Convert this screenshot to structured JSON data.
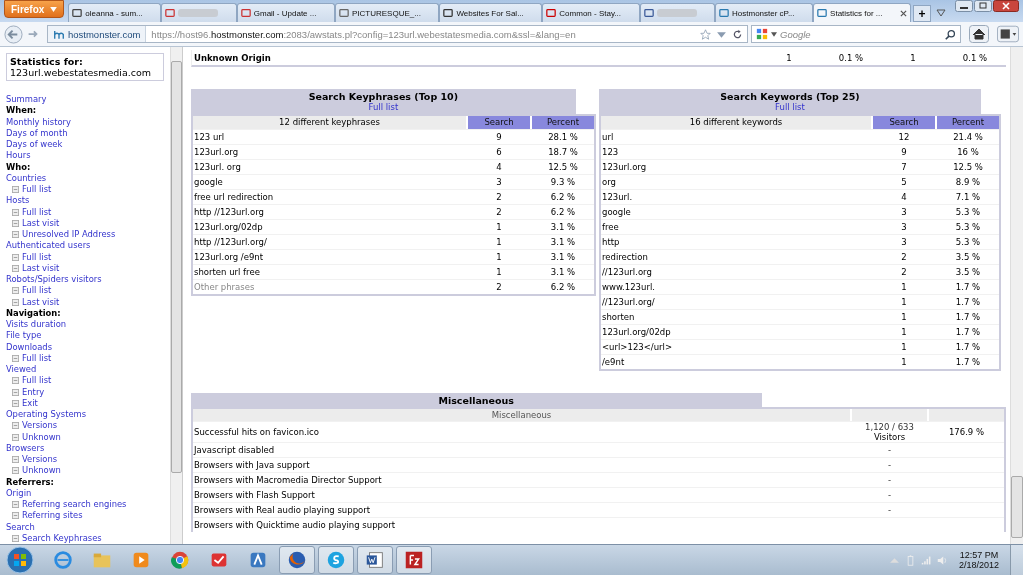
{
  "browser": {
    "menu_button": "Firefox",
    "tabs": [
      {
        "title": "oleanna - sum...",
        "redacted": false,
        "selected": false
      },
      {
        "redacted": true,
        "selected": false
      },
      {
        "title": "Gmail - Update ...",
        "redacted": false,
        "selected": false
      },
      {
        "title": "PICTURESQUE_...",
        "redacted": false,
        "selected": false
      },
      {
        "title": "Websites For Sal...",
        "redacted": false,
        "selected": false
      },
      {
        "title": "Common - Stay...",
        "redacted": false,
        "selected": false
      },
      {
        "redacted": true,
        "selected": false
      },
      {
        "title": "Hostmonster cP...",
        "redacted": false,
        "selected": false
      },
      {
        "title": "Statistics for ...",
        "redacted": false,
        "selected": true
      }
    ],
    "new_tab": "+",
    "site_identity": "hostmonster.com",
    "url": "https://host96.**hostmonster.com**:2083/awstats.pl?config=123url.webestatesmedia.com&ssl=&lang=en",
    "search": {
      "placeholder": "Google"
    }
  },
  "sidebar": {
    "stats_for_label": "Statistics for:",
    "domain": "123url.webestatesmedia.com",
    "items": [
      {
        "kind": "link",
        "text": "Summary"
      },
      {
        "kind": "heading",
        "text": "When:"
      },
      {
        "kind": "link",
        "text": "Monthly history"
      },
      {
        "kind": "link",
        "text": "Days of month"
      },
      {
        "kind": "link",
        "text": "Days of week"
      },
      {
        "kind": "link",
        "text": "Hours"
      },
      {
        "kind": "heading",
        "text": "Who:"
      },
      {
        "kind": "link",
        "text": "Countries"
      },
      {
        "kind": "sublink",
        "text": "Full list"
      },
      {
        "kind": "link",
        "text": "Hosts"
      },
      {
        "kind": "sublink",
        "text": "Full list"
      },
      {
        "kind": "sublink",
        "text": "Last visit"
      },
      {
        "kind": "sublink",
        "text": "Unresolved IP Address"
      },
      {
        "kind": "link",
        "text": "Authenticated users"
      },
      {
        "kind": "sublink",
        "text": "Full list"
      },
      {
        "kind": "sublink",
        "text": "Last visit"
      },
      {
        "kind": "link",
        "text": "Robots/Spiders visitors"
      },
      {
        "kind": "sublink",
        "text": "Full list"
      },
      {
        "kind": "sublink",
        "text": "Last visit"
      },
      {
        "kind": "heading",
        "text": "Navigation:"
      },
      {
        "kind": "link",
        "text": "Visits duration"
      },
      {
        "kind": "link",
        "text": "File type"
      },
      {
        "kind": "link",
        "text": "Downloads"
      },
      {
        "kind": "sublink",
        "text": "Full list"
      },
      {
        "kind": "link",
        "text": "Viewed"
      },
      {
        "kind": "sublink",
        "text": "Full list"
      },
      {
        "kind": "sublink",
        "text": "Entry"
      },
      {
        "kind": "sublink",
        "text": "Exit"
      },
      {
        "kind": "link",
        "text": "Operating Systems"
      },
      {
        "kind": "sublink",
        "text": "Versions"
      },
      {
        "kind": "sublink",
        "text": "Unknown"
      },
      {
        "kind": "link",
        "text": "Browsers"
      },
      {
        "kind": "sublink",
        "text": "Versions"
      },
      {
        "kind": "sublink",
        "text": "Unknown"
      },
      {
        "kind": "heading",
        "text": "Referrers:"
      },
      {
        "kind": "link",
        "text": "Origin"
      },
      {
        "kind": "sublink",
        "text": "Referring search engines"
      },
      {
        "kind": "sublink",
        "text": "Referring sites"
      },
      {
        "kind": "link",
        "text": "Search"
      },
      {
        "kind": "sublink",
        "text": "Search Keyphrases"
      }
    ]
  },
  "origin_row": {
    "label": "Unknown Origin",
    "pages": "1",
    "pages_percent": "0.1 %",
    "hits": "1",
    "hits_percent": "0.1 %"
  },
  "keyphrases": {
    "title": "Search Keyphrases (Top 10)",
    "full_list": "Full list",
    "count_label": "12 different keyphrases",
    "columns": [
      "Search",
      "Percent"
    ],
    "rows": [
      {
        "text": "123 url",
        "search": "9",
        "percent": "28.1 %",
        "muted": false
      },
      {
        "text": "123url.org",
        "search": "6",
        "percent": "18.7 %",
        "muted": false
      },
      {
        "text": "123url. org",
        "search": "4",
        "percent": "12.5 %",
        "muted": false
      },
      {
        "text": "google",
        "search": "3",
        "percent": "9.3 %",
        "muted": false
      },
      {
        "text": "free url redirection",
        "search": "2",
        "percent": "6.2 %",
        "muted": false
      },
      {
        "text": "http //123url.org",
        "search": "2",
        "percent": "6.2 %",
        "muted": false
      },
      {
        "text": "123url.org/02dp",
        "search": "1",
        "percent": "3.1 %",
        "muted": false
      },
      {
        "text": "http //123url.org/",
        "search": "1",
        "percent": "3.1 %",
        "muted": false
      },
      {
        "text": "123url.org /e9nt",
        "search": "1",
        "percent": "3.1 %",
        "muted": false
      },
      {
        "text": "shorten url free",
        "search": "1",
        "percent": "3.1 %",
        "muted": false
      },
      {
        "text": "Other phrases",
        "search": "2",
        "percent": "6.2 %",
        "muted": true
      }
    ]
  },
  "keywords": {
    "title": "Search Keywords (Top 25)",
    "full_list": "Full list",
    "count_label": "16 different keywords",
    "columns": [
      "Search",
      "Percent"
    ],
    "rows": [
      {
        "text": "url",
        "search": "12",
        "percent": "21.4 %"
      },
      {
        "text": "123",
        "search": "9",
        "percent": "16 %"
      },
      {
        "text": "123url.org",
        "search": "7",
        "percent": "12.5 %"
      },
      {
        "text": "org",
        "search": "5",
        "percent": "8.9 %"
      },
      {
        "text": "123url.",
        "search": "4",
        "percent": "7.1 %"
      },
      {
        "text": "google",
        "search": "3",
        "percent": "5.3 %"
      },
      {
        "text": "free",
        "search": "3",
        "percent": "5.3 %"
      },
      {
        "text": "http",
        "search": "3",
        "percent": "5.3 %"
      },
      {
        "text": "redirection",
        "search": "2",
        "percent": "3.5 %"
      },
      {
        "text": "//123url.org",
        "search": "2",
        "percent": "3.5 %"
      },
      {
        "text": "www.123url.",
        "search": "1",
        "percent": "1.7 %"
      },
      {
        "text": "//123url.org/",
        "search": "1",
        "percent": "1.7 %"
      },
      {
        "text": "shorten",
        "search": "1",
        "percent": "1.7 %"
      },
      {
        "text": "123url.org/02dp",
        "search": "1",
        "percent": "1.7 %"
      },
      {
        "text": "<url>123</url>",
        "search": "1",
        "percent": "1.7 %"
      },
      {
        "text": "/e9nt",
        "search": "1",
        "percent": "1.7 %"
      }
    ]
  },
  "miscellaneous": {
    "title": "Miscellaneous",
    "header": "Miscellaneous",
    "rows": [
      {
        "label": "Successful hits on favicon.ico",
        "value": "1,120 / 633",
        "unit": "Visitors",
        "percent": "176.9 %"
      },
      {
        "label": "Javascript disabled",
        "value": "-"
      },
      {
        "label": "Browsers with Java support",
        "value": "-"
      },
      {
        "label": "Browsers with Macromedia Director Support",
        "value": "-"
      },
      {
        "label": "Browsers with Flash Support",
        "value": "-"
      },
      {
        "label": "Browsers with Real audio playing support",
        "value": "-"
      },
      {
        "label": "Browsers with Quicktime audio playing support"
      }
    ]
  },
  "taskbar": {
    "apps": [
      {
        "selected": false
      },
      {
        "selected": false
      },
      {
        "selected": false
      },
      {
        "selected": false
      },
      {
        "selected": false
      },
      {
        "selected": false
      },
      {
        "selected": true
      },
      {
        "selected": true
      },
      {
        "selected": true
      },
      {
        "selected": true
      }
    ],
    "time": "12:57 PM",
    "date": "2/18/2012"
  }
}
